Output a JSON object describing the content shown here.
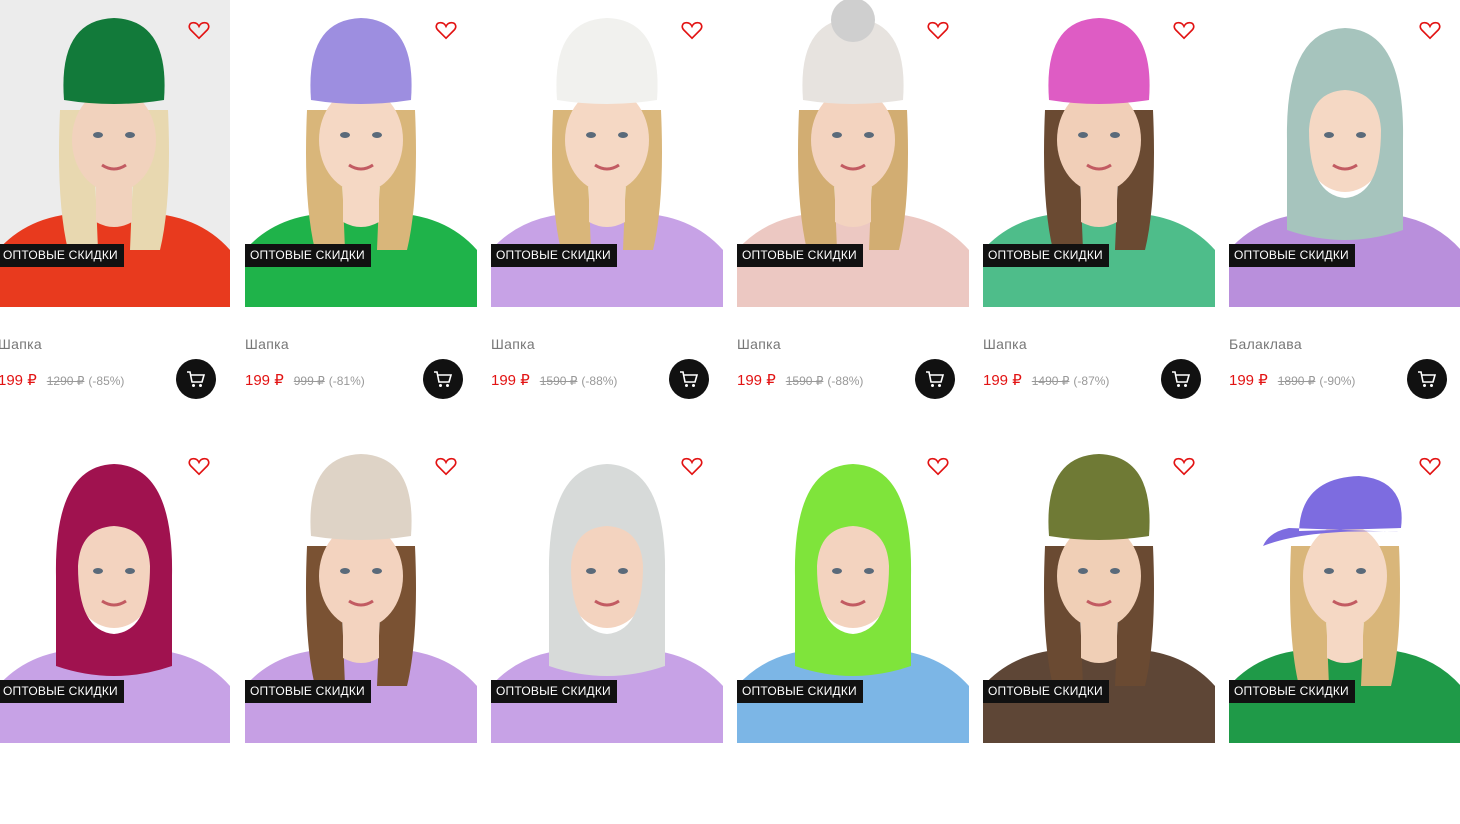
{
  "badge_text": "ОПТОВЫЕ СКИДКИ",
  "products": [
    {
      "title": "Шапка",
      "price": "199 ₽",
      "old_price": "1290 ₽",
      "discount": "(-85%)",
      "hat_color": "#127a3a",
      "bg": "#ececec",
      "top_color": "#e83a1e",
      "skin": "#f1d2bd",
      "hair": "#e8d8b0",
      "hat_type": "beanie"
    },
    {
      "title": "Шапка",
      "price": "199 ₽",
      "old_price": "999 ₽",
      "discount": "(-81%)",
      "hat_color": "#9d8ee0",
      "bg": "#ffffff",
      "top_color": "#1fb34a",
      "skin": "#f5d8c4",
      "hair": "#d9b67a",
      "hat_type": "beanie"
    },
    {
      "title": "Шапка",
      "price": "199 ₽",
      "old_price": "1590 ₽",
      "discount": "(-88%)",
      "hat_color": "#f1f1ee",
      "bg": "#ffffff",
      "top_color": "#c7a2e6",
      "skin": "#f5d8c4",
      "hair": "#d9b67a",
      "hat_type": "beanie"
    },
    {
      "title": "Шапка",
      "price": "199 ₽",
      "old_price": "1590 ₽",
      "discount": "(-88%)",
      "hat_color": "#e7e3df",
      "bg": "#ffffff",
      "top_color": "#ecc8c2",
      "skin": "#f3d3bf",
      "hair": "#d2ad72",
      "hat_type": "pompom"
    },
    {
      "title": "Шапка",
      "price": "199 ₽",
      "old_price": "1490 ₽",
      "discount": "(-87%)",
      "hat_color": "#de5cc4",
      "bg": "#ffffff",
      "top_color": "#4ebd8a",
      "skin": "#f1cfb8",
      "hair": "#6a4a32",
      "hat_type": "beanie"
    },
    {
      "title": "Балаклава",
      "price": "199 ₽",
      "old_price": "1890 ₽",
      "discount": "(-90%)",
      "hat_color": "#a6c4bd",
      "bg": "#ffffff",
      "top_color": "#b98fdc",
      "skin": "#f5d8c4",
      "hair": "#d9b67a",
      "hat_type": "balaclava"
    },
    {
      "title": "",
      "price": "",
      "old_price": "",
      "discount": "",
      "hat_color": "#a0124f",
      "bg": "#ffffff",
      "top_color": "#c7a2e6",
      "skin": "#f3d3bf",
      "hair": "#a0124f",
      "hat_type": "hood"
    },
    {
      "title": "",
      "price": "",
      "old_price": "",
      "discount": "",
      "hat_color": "#ded3c6",
      "bg": "#ffffff",
      "top_color": "#c69fe4",
      "skin": "#f3d3bf",
      "hair": "#7a5233",
      "hat_type": "beanie"
    },
    {
      "title": "",
      "price": "",
      "old_price": "",
      "discount": "",
      "hat_color": "#d7dad9",
      "bg": "#ffffff",
      "top_color": "#c7a2e6",
      "skin": "#f3d3bf",
      "hair": "#d7dad9",
      "hat_type": "balaclava"
    },
    {
      "title": "",
      "price": "",
      "old_price": "",
      "discount": "",
      "hat_color": "#7fe43b",
      "bg": "#ffffff",
      "top_color": "#7cb6e6",
      "skin": "#f3d3bf",
      "hair": "#7fe43b",
      "hat_type": "balaclava"
    },
    {
      "title": "",
      "price": "",
      "old_price": "",
      "discount": "",
      "hat_color": "#6f7a35",
      "bg": "#ffffff",
      "top_color": "#5e4636",
      "skin": "#f0cfb6",
      "hair": "#6a4a32",
      "hat_type": "beanie"
    },
    {
      "title": "",
      "price": "",
      "old_price": "",
      "discount": "",
      "hat_color": "#7d6ce0",
      "bg": "#ffffff",
      "top_color": "#1f9a48",
      "skin": "#f5d8c4",
      "hair": "#d9b67a",
      "hat_type": "cap"
    }
  ],
  "icons": {
    "favorite": "heart-outline-icon",
    "cart": "shopping-cart-icon"
  },
  "colors": {
    "price": "#e21313",
    "badge_bg": "#111111",
    "heart": "#e21313"
  }
}
